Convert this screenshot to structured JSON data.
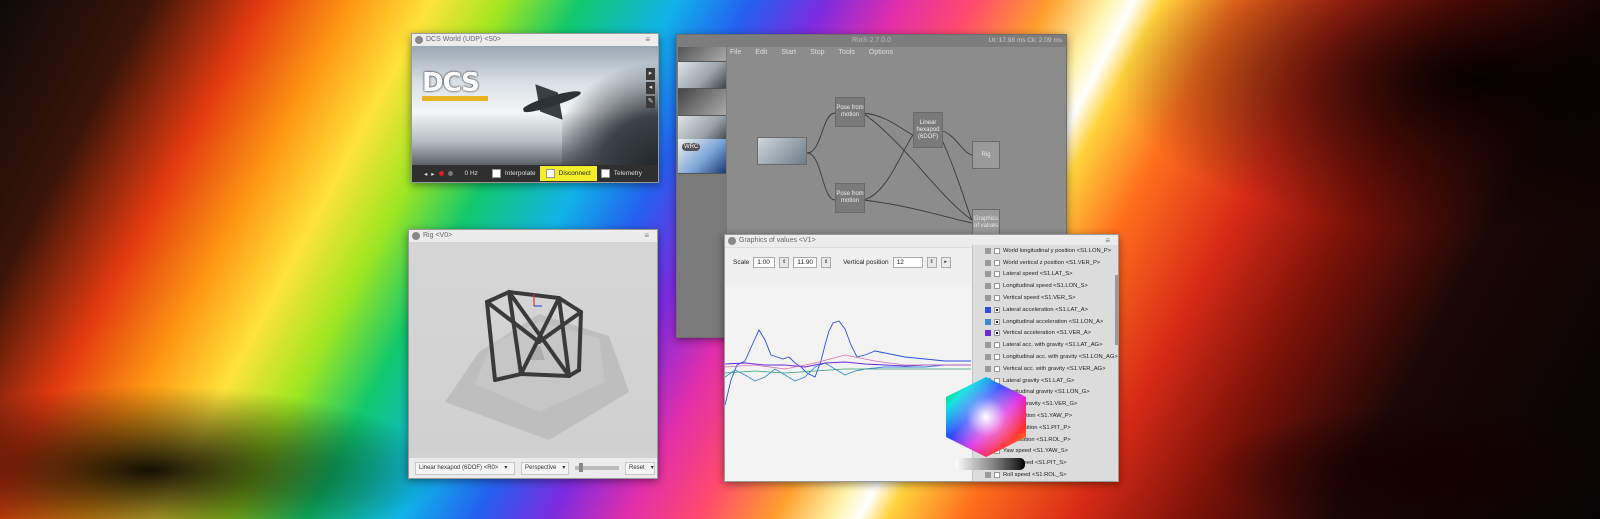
{
  "dcs_window": {
    "title": "DCS World (UDP) <S0>",
    "logo_text": "DCS",
    "status": {
      "rate": "0 Hz",
      "interpolate_label": "Interpolate",
      "disconnect_label": "Disconnect",
      "telemetry_label": "Telemetry"
    }
  },
  "main_window": {
    "title": "Rio® 2.7.0.0",
    "stats": "Ut: 17.98 ms   Ck: 2.09 ms",
    "menu": [
      "File",
      "Edit",
      "Start",
      "Stop",
      "Tools",
      "Options"
    ],
    "thumbnail_badge": "WRC",
    "nodes": {
      "pose1": "Pose from motion",
      "pose2": "Pose from motion",
      "hexapod": "Linear hexapod (6DOF)",
      "rig": "Rig",
      "graphics": "Graphics of values"
    }
  },
  "rig_window": {
    "title": "Rig <V0>",
    "model_select": "Linear hexapod (6DOF) <R0>",
    "view_select": "Perspective",
    "reset_label": "Reset"
  },
  "graph_window": {
    "title": "Graphics of values <V1>",
    "scale_label": "Scale",
    "scale_from": "1:00",
    "scale_to": "11.90",
    "vertical_label": "Vertical position",
    "vertical_value": "12",
    "play_icon": "play-icon",
    "legend": [
      {
        "label": "World longitudinal y position <S1.LON_P>",
        "color": "#9a9a9a",
        "checked": false
      },
      {
        "label": "World vertical z position <S1.VER_P>",
        "color": "#9a9a9a",
        "checked": false
      },
      {
        "label": "Lateral speed <S1.LAT_S>",
        "color": "#9a9a9a",
        "checked": false
      },
      {
        "label": "Longitudinal speed <S1.LON_S>",
        "color": "#9a9a9a",
        "checked": false
      },
      {
        "label": "Vertical speed <S1.VER_S>",
        "color": "#9a9a9a",
        "checked": false
      },
      {
        "label": "Lateral acceleration <S1.LAT_A>",
        "color": "#2a4fe0",
        "checked": true
      },
      {
        "label": "Longitudinal acceleration <S1.LON_A>",
        "color": "#3a8ad8",
        "checked": true
      },
      {
        "label": "Vertical acceleration <S1.VER_A>",
        "color": "#6a2ad8",
        "checked": true
      },
      {
        "label": "Lateral acc. with gravity <S1.LAT_AG>",
        "color": "#9a9a9a",
        "checked": false
      },
      {
        "label": "Longitudinal acc. with gravity <S1.LON_AG>",
        "color": "#9a9a9a",
        "checked": false
      },
      {
        "label": "Vertical acc. with gravity <S1.VER_AG>",
        "color": "#9a9a9a",
        "checked": false
      },
      {
        "label": "Lateral gravity <S1.LAT_G>",
        "color": "#9a9a9a",
        "checked": false
      },
      {
        "label": "Longitudinal gravity <S1.LON_G>",
        "color": "#9a9a9a",
        "checked": false
      },
      {
        "label": "Vertical gravity <S1.VER_G>",
        "color": "#9a9a9a",
        "checked": false
      },
      {
        "label": "Yaw position <S1.YAW_P>",
        "color": "#9a9a9a",
        "checked": false
      },
      {
        "label": "Pitch position <S1.PIT_P>",
        "color": "#9a9a9a",
        "checked": false
      },
      {
        "label": "Roll position <S1.ROL_P>",
        "color": "#9a9a9a",
        "checked": false
      },
      {
        "label": "Yaw speed <S1.YAW_S>",
        "color": "#9a9a9a",
        "checked": false
      },
      {
        "label": "Pitch speed <S1.PIT_S>",
        "color": "#9a9a9a",
        "checked": false
      },
      {
        "label": "Roll speed <S1.ROL_S>",
        "color": "#9a9a9a",
        "checked": false
      }
    ]
  },
  "colors": {
    "accent_yellow": "#f2ee2a",
    "record_red": "#e02020",
    "series_blue": "#2a4fe0",
    "series_teal": "#3a8ad8",
    "series_purple": "#6a2ad8"
  }
}
